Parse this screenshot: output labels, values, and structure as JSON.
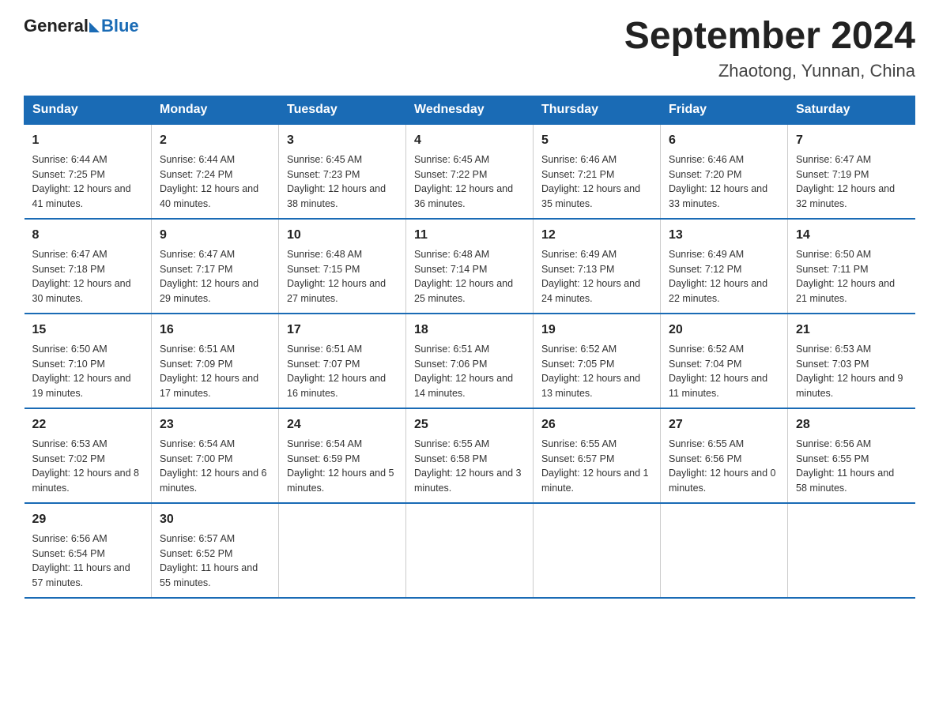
{
  "header": {
    "logo_text_main": "General",
    "logo_text_sub": "Blue",
    "calendar_title": "September 2024",
    "calendar_subtitle": "Zhaotong, Yunnan, China"
  },
  "days_of_week": [
    "Sunday",
    "Monday",
    "Tuesday",
    "Wednesday",
    "Thursday",
    "Friday",
    "Saturday"
  ],
  "weeks": [
    [
      {
        "day": "1",
        "sunrise": "6:44 AM",
        "sunset": "7:25 PM",
        "daylight": "12 hours and 41 minutes."
      },
      {
        "day": "2",
        "sunrise": "6:44 AM",
        "sunset": "7:24 PM",
        "daylight": "12 hours and 40 minutes."
      },
      {
        "day": "3",
        "sunrise": "6:45 AM",
        "sunset": "7:23 PM",
        "daylight": "12 hours and 38 minutes."
      },
      {
        "day": "4",
        "sunrise": "6:45 AM",
        "sunset": "7:22 PM",
        "daylight": "12 hours and 36 minutes."
      },
      {
        "day": "5",
        "sunrise": "6:46 AM",
        "sunset": "7:21 PM",
        "daylight": "12 hours and 35 minutes."
      },
      {
        "day": "6",
        "sunrise": "6:46 AM",
        "sunset": "7:20 PM",
        "daylight": "12 hours and 33 minutes."
      },
      {
        "day": "7",
        "sunrise": "6:47 AM",
        "sunset": "7:19 PM",
        "daylight": "12 hours and 32 minutes."
      }
    ],
    [
      {
        "day": "8",
        "sunrise": "6:47 AM",
        "sunset": "7:18 PM",
        "daylight": "12 hours and 30 minutes."
      },
      {
        "day": "9",
        "sunrise": "6:47 AM",
        "sunset": "7:17 PM",
        "daylight": "12 hours and 29 minutes."
      },
      {
        "day": "10",
        "sunrise": "6:48 AM",
        "sunset": "7:15 PM",
        "daylight": "12 hours and 27 minutes."
      },
      {
        "day": "11",
        "sunrise": "6:48 AM",
        "sunset": "7:14 PM",
        "daylight": "12 hours and 25 minutes."
      },
      {
        "day": "12",
        "sunrise": "6:49 AM",
        "sunset": "7:13 PM",
        "daylight": "12 hours and 24 minutes."
      },
      {
        "day": "13",
        "sunrise": "6:49 AM",
        "sunset": "7:12 PM",
        "daylight": "12 hours and 22 minutes."
      },
      {
        "day": "14",
        "sunrise": "6:50 AM",
        "sunset": "7:11 PM",
        "daylight": "12 hours and 21 minutes."
      }
    ],
    [
      {
        "day": "15",
        "sunrise": "6:50 AM",
        "sunset": "7:10 PM",
        "daylight": "12 hours and 19 minutes."
      },
      {
        "day": "16",
        "sunrise": "6:51 AM",
        "sunset": "7:09 PM",
        "daylight": "12 hours and 17 minutes."
      },
      {
        "day": "17",
        "sunrise": "6:51 AM",
        "sunset": "7:07 PM",
        "daylight": "12 hours and 16 minutes."
      },
      {
        "day": "18",
        "sunrise": "6:51 AM",
        "sunset": "7:06 PM",
        "daylight": "12 hours and 14 minutes."
      },
      {
        "day": "19",
        "sunrise": "6:52 AM",
        "sunset": "7:05 PM",
        "daylight": "12 hours and 13 minutes."
      },
      {
        "day": "20",
        "sunrise": "6:52 AM",
        "sunset": "7:04 PM",
        "daylight": "12 hours and 11 minutes."
      },
      {
        "day": "21",
        "sunrise": "6:53 AM",
        "sunset": "7:03 PM",
        "daylight": "12 hours and 9 minutes."
      }
    ],
    [
      {
        "day": "22",
        "sunrise": "6:53 AM",
        "sunset": "7:02 PM",
        "daylight": "12 hours and 8 minutes."
      },
      {
        "day": "23",
        "sunrise": "6:54 AM",
        "sunset": "7:00 PM",
        "daylight": "12 hours and 6 minutes."
      },
      {
        "day": "24",
        "sunrise": "6:54 AM",
        "sunset": "6:59 PM",
        "daylight": "12 hours and 5 minutes."
      },
      {
        "day": "25",
        "sunrise": "6:55 AM",
        "sunset": "6:58 PM",
        "daylight": "12 hours and 3 minutes."
      },
      {
        "day": "26",
        "sunrise": "6:55 AM",
        "sunset": "6:57 PM",
        "daylight": "12 hours and 1 minute."
      },
      {
        "day": "27",
        "sunrise": "6:55 AM",
        "sunset": "6:56 PM",
        "daylight": "12 hours and 0 minutes."
      },
      {
        "day": "28",
        "sunrise": "6:56 AM",
        "sunset": "6:55 PM",
        "daylight": "11 hours and 58 minutes."
      }
    ],
    [
      {
        "day": "29",
        "sunrise": "6:56 AM",
        "sunset": "6:54 PM",
        "daylight": "11 hours and 57 minutes."
      },
      {
        "day": "30",
        "sunrise": "6:57 AM",
        "sunset": "6:52 PM",
        "daylight": "11 hours and 55 minutes."
      },
      null,
      null,
      null,
      null,
      null
    ]
  ],
  "labels": {
    "sunrise_prefix": "Sunrise: ",
    "sunset_prefix": "Sunset: ",
    "daylight_prefix": "Daylight: "
  }
}
